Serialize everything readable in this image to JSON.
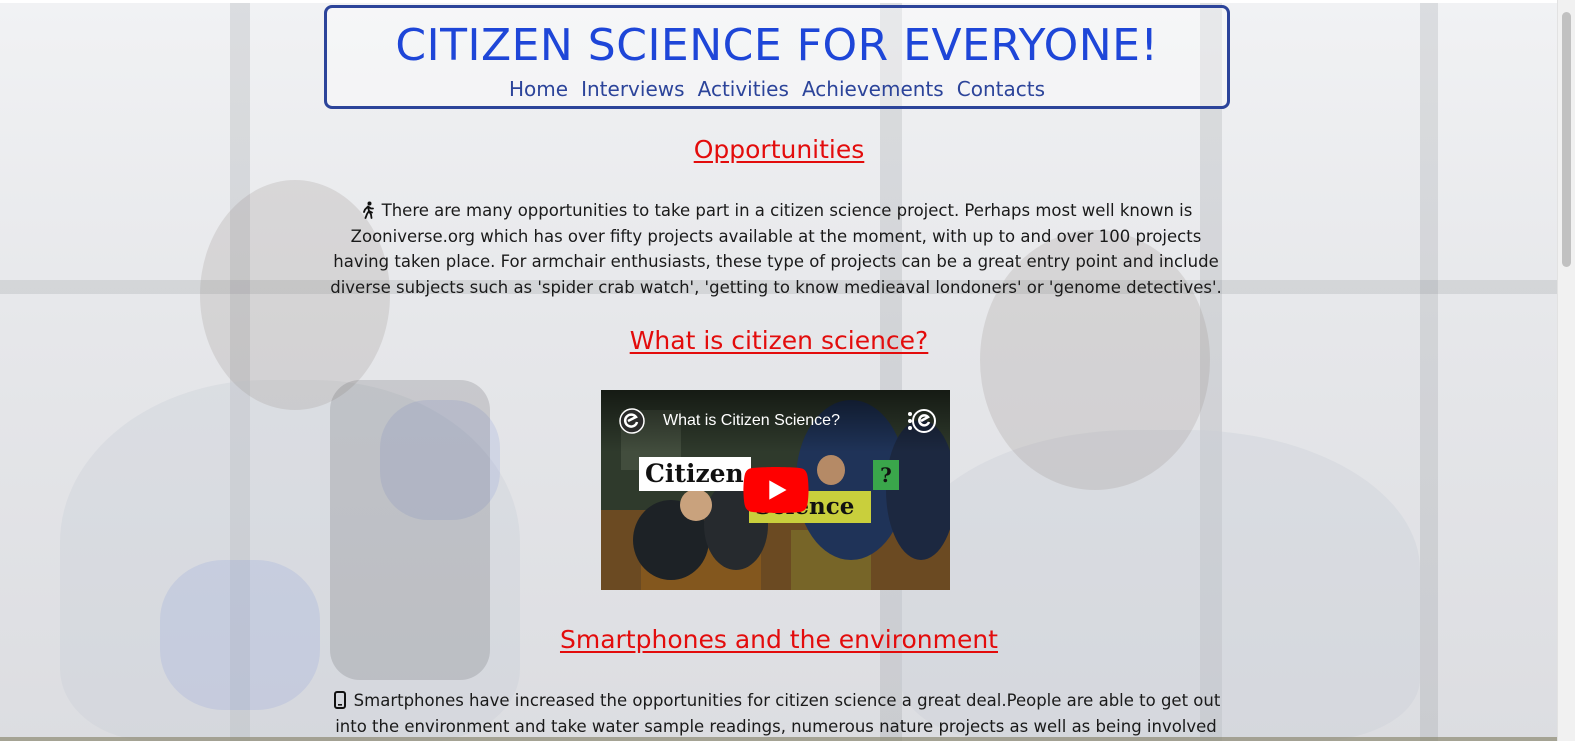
{
  "header": {
    "title": "CITIZEN SCIENCE FOR EVERYONE!",
    "nav": [
      "Home",
      "Interviews",
      "Activities",
      "Achievements",
      "Contacts"
    ]
  },
  "sections": {
    "opportunities": {
      "heading": "Opportunities",
      "icon": "walking-person-icon",
      "text": "There are many opportunities to take part in a citizen science project. Perhaps most well known is Zooniverse.org which has over fifty projects available at the moment, with up to and over 100 projects having taken place. For armchair enthusiasts, these type of projects can be a great entry point and include diverse subjects such as 'spider crab watch', 'getting to know medieaval londoners' or 'genome detectives'."
    },
    "what_is": {
      "heading": "What is citizen science?",
      "video": {
        "title": "What is Citizen Science?",
        "card_word_1": "Citizen",
        "card_word_2": "Science",
        "card_mark": "?",
        "play_icon": "youtube-play-icon"
      }
    },
    "smartphones": {
      "heading": "Smartphones and the environment",
      "icon": "smartphone-icon",
      "text": "Smartphones have increased the opportunities for citizen science a great deal.People are able to get out into the environment and take water sample readings, numerous nature projects as well as being involved in 'citizen sensing', a"
    }
  },
  "colors": {
    "title": "#1e46d8",
    "nav": "#2c449a",
    "heading": "#e30c0c",
    "border": "#2c449a"
  }
}
